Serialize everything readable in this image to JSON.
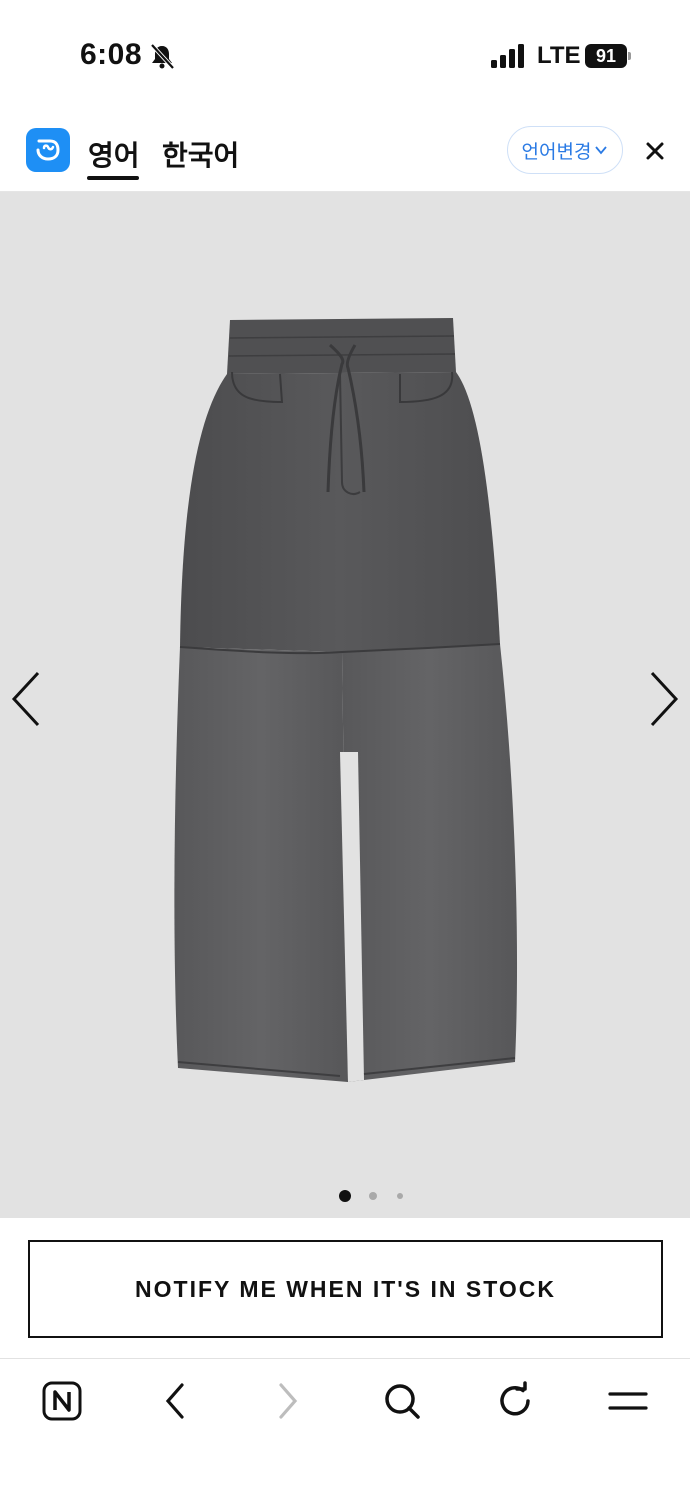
{
  "status_bar": {
    "time": "6:08",
    "network": "LTE",
    "battery": "91",
    "icons": [
      "mute-icon",
      "signal-icon",
      "battery-icon"
    ]
  },
  "translate_bar": {
    "tab_source": "영어",
    "tab_target": "한국어",
    "change_language": "언어변경",
    "icons": [
      "translate-logo-icon",
      "chevron-down-icon",
      "close-icon"
    ]
  },
  "gallery": {
    "slide_count": 3,
    "active_slide": 1,
    "background": "#e2e2e2",
    "icons": [
      "chevron-left-icon",
      "chevron-right-icon"
    ]
  },
  "notify": {
    "label": "NOTIFY ME WHEN IT'S IN STOCK"
  },
  "toolbar": {
    "items": [
      "naver-home-icon",
      "back-icon",
      "forward-icon",
      "search-icon",
      "refresh-icon",
      "menu-icon"
    ]
  }
}
